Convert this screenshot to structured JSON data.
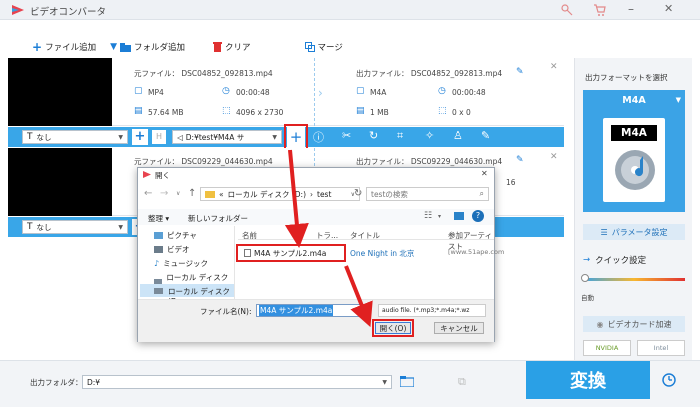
{
  "app": {
    "title": "ビデオコンバータ"
  },
  "toolbar": {
    "add_file": "ファイル追加",
    "add_folder": "フォルダ追加",
    "clear": "クリア",
    "merge": "マージ"
  },
  "file1": {
    "src_name": "元ファイル： DSC04852_092813.mp4",
    "src_format": "MP4",
    "src_duration": "00:00:48",
    "src_size": "57.64 MB",
    "src_res": "4096 x 2730",
    "out_name": "出力ファイル： DSC04852_092813.mp4",
    "out_format": "M4A",
    "out_duration": "00:00:48",
    "out_size": "1 MB",
    "out_res": "0 x 0"
  },
  "bar1": {
    "subtitle": "なし",
    "audio": "D:¥test¥M4A サ"
  },
  "file2": {
    "src_name": "元ファイル： DSC09229_044630.mp4",
    "out_name": "出力ファイル： DSC09229_044630.mp4",
    "out_res_partial": "16"
  },
  "bar2": {
    "subtitle": "なし"
  },
  "right": {
    "format_label": "出力フォーマットを選択",
    "format": "M4A",
    "badge": "M4A",
    "params": "パラメータ設定",
    "quick": "クイック設定",
    "auto": "自動",
    "gpu": "ビデオカード加速",
    "nvidia": "NVIDIA",
    "intel": "Intel"
  },
  "bottom": {
    "folder_label": "出力フォルダ：",
    "folder_value": "D:¥",
    "convert": "変換"
  },
  "dialog": {
    "title": "開く",
    "path_prefix": "«",
    "path": "ローカル ディスク (D:)",
    "path_sep": "›",
    "path_last": "test",
    "search_placeholder": "testの検索",
    "organize": "整理",
    "new_folder": "新しいフォルダー",
    "sidebar": [
      "ピクチャ",
      "ビデオ",
      "ミュージック",
      "ローカル ディスク (C",
      "ローカル ディスク (D"
    ],
    "columns": {
      "name": "名前",
      "track": "トラ...",
      "title": "タイトル",
      "artist": "参加アーティスト"
    },
    "file": {
      "name": "M4A サンプル2.m4a",
      "title": "One Night in 北京",
      "artist": "[www.51ape.com"
    },
    "filename_label": "ファイル名(N):",
    "filename_value": "M4A サンプル2.m4a",
    "filter": "audio file. (*.mp3;*.m4a;*.wz",
    "open": "開く(O)",
    "cancel": "キャンセル"
  }
}
